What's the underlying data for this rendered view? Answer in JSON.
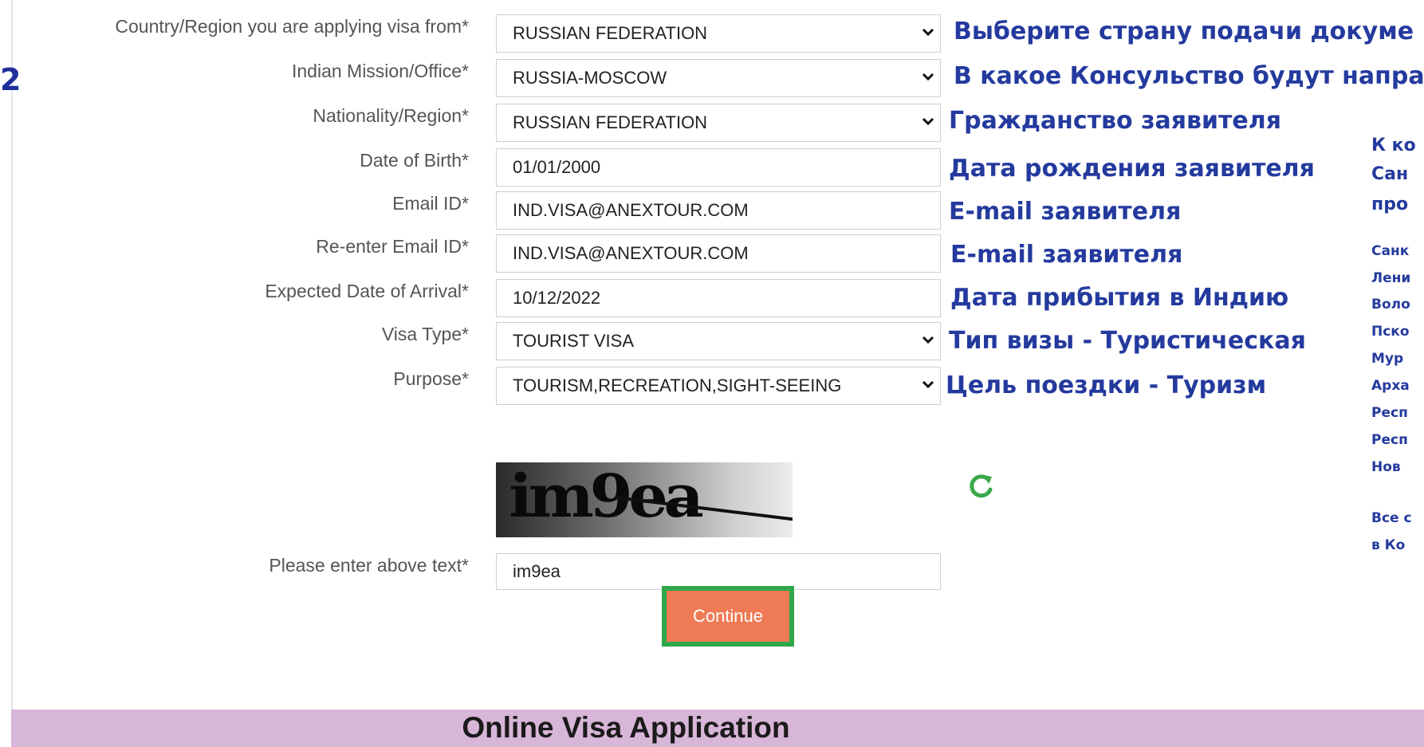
{
  "step_number": "2",
  "form": {
    "country": {
      "label": "Country/Region you are applying visa from*",
      "value": "RUSSIAN FEDERATION",
      "note": "Выберите страну подачи докуме"
    },
    "mission": {
      "label": "Indian Mission/Office*",
      "value": "RUSSIA-MOSCOW",
      "note": "В какое Консульство будут напра"
    },
    "nationality": {
      "label": "Nationality/Region*",
      "value": "RUSSIAN FEDERATION",
      "note": "Гражданство заявителя"
    },
    "dob": {
      "label": "Date of Birth*",
      "value": "01/01/2000",
      "note": "Дата рождения заявителя"
    },
    "email": {
      "label": "Email ID*",
      "value": "IND.VISA@ANEXTOUR.COM",
      "note": "E-mail заявителя"
    },
    "email_confirm": {
      "label": "Re-enter Email ID*",
      "value": "IND.VISA@ANEXTOUR.COM",
      "note": "E-mail заявителя"
    },
    "arrival": {
      "label": "Expected Date of Arrival*",
      "value": "10/12/2022",
      "note": "Дата прибытия в Индию"
    },
    "visa_type": {
      "label": "Visa Type*",
      "value": "TOURIST VISA",
      "note": "Тип визы - Туристическая"
    },
    "purpose": {
      "label": "Purpose*",
      "value": "TOURISM,RECREATION,SIGHT-SEEING",
      "note": "Цель поездки - Туризм"
    },
    "captcha": {
      "image_text": "im9ea",
      "label": "Please enter above text*",
      "value": "im9ea"
    },
    "continue_label": "Continue"
  },
  "side_notes": {
    "heading": [
      "К ко",
      "Сан",
      "про"
    ],
    "regions": [
      "Санк",
      "Лени",
      "Воло",
      "Пско",
      "Мур",
      "Арха",
      "Респ",
      "Респ",
      "Нов"
    ],
    "footer": [
      "Все с",
      "в Ко"
    ]
  },
  "footer_title": "Online Visa Application",
  "colors": {
    "note_blue": "#243a9e",
    "continue_orange": "#ee7b55",
    "continue_border": "#2fa84a",
    "footer_bar": "#d8b6d8",
    "refresh_green": "#3aa84a"
  }
}
